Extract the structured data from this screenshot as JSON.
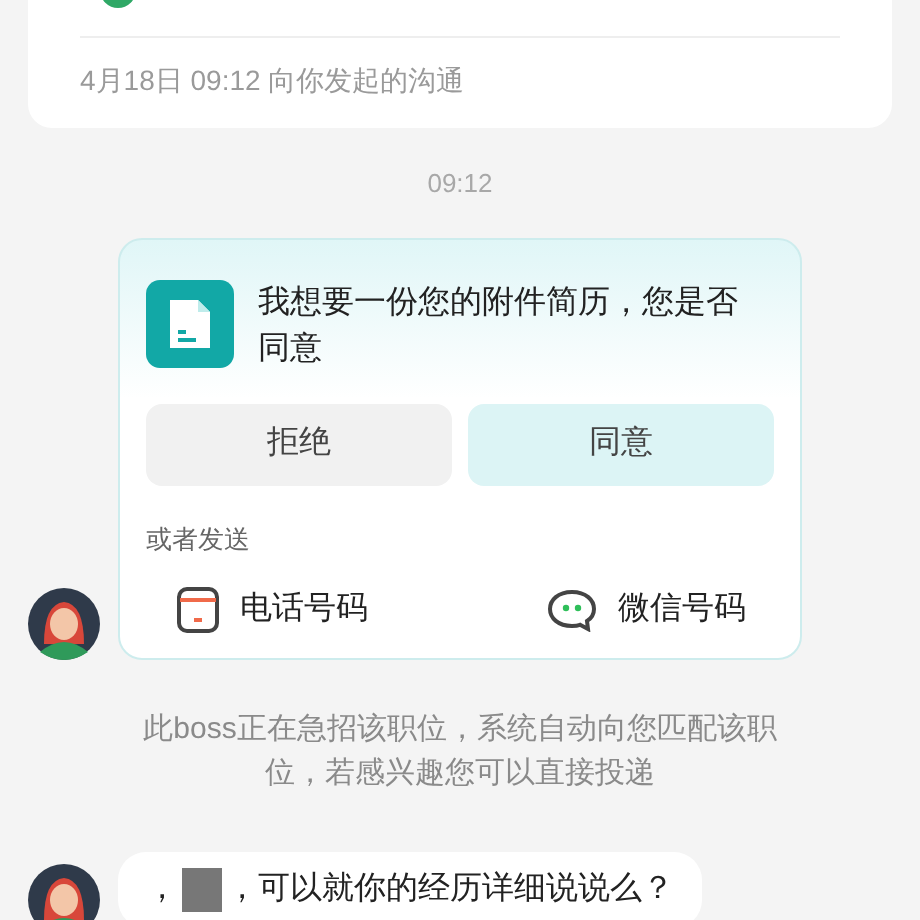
{
  "top_card": {
    "note": "4月18日 09:12 向你发起的沟通"
  },
  "timestamp": "09:12",
  "request_card": {
    "message": "我想要一份您的附件简历，您是否同意",
    "buttons": [
      {
        "label": "拒绝",
        "kind": "reject"
      },
      {
        "label": "同意",
        "kind": "accept"
      }
    ],
    "alt_label": "或者发送",
    "options": [
      {
        "label": "电话号码",
        "kind": "phone"
      },
      {
        "label": "微信号码",
        "kind": "wechat"
      }
    ]
  },
  "system_notice": "此boss正在急招该职位，系统自动向您匹配该职位，若感兴趣您可以直接投递",
  "last_message": {
    "prefix": "，",
    "text": "，可以就你的经历详细说说么？"
  }
}
